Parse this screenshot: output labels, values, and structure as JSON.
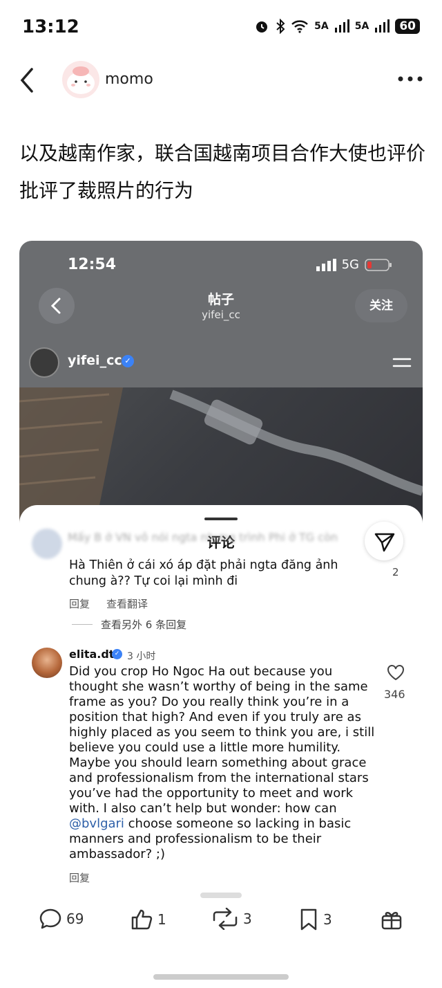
{
  "status_bar": {
    "time": "13:12",
    "network_1": "5A",
    "network_2": "5A",
    "battery": "60"
  },
  "header": {
    "author": "momo"
  },
  "post": {
    "text": "以及越南作家，联合国越南项目合作大使也评价批评了裁照片的行为"
  },
  "screenshot": {
    "status_time": "12:54",
    "network": "5G",
    "page_title": "帖子",
    "page_subtitle": "yifei_cc",
    "follow_label": "关注",
    "post_user": "yifei_cc",
    "sheet_title": "评论",
    "comment1": {
      "blurred_text": "Mấy B ở VN vô nói ngta nhưng trình Phi ở TG còn",
      "text": "Hà Thiên ở cái xó áp đặt phải ngta đăng ảnh chung à?? Tự coi lại mình đi",
      "likes": "2",
      "reply_label": "回复",
      "translate_label": "查看翻译",
      "more_replies": "查看另外 6 条回复"
    },
    "comment2": {
      "user": "elita.dt",
      "time": "3 小时",
      "text_before_mention": "Did you crop Ho Ngoc Ha out because you thought she wasn’t worthy of being in the same frame as you? Do you really think you’re in a position that high? And even if you truly are as highly placed as you seem to think you are, i still believe you could use a little more humility. Maybe you should learn something about grace and professionalism from the international stars you’ve had the opportunity to meet and work with. I also can’t help but wonder: how can ",
      "mention": "@bvlgari",
      "text_after_mention": " choose someone so lacking in basic manners and professionalism to be their ambassador? ;)",
      "likes": "346",
      "reply_label": "回复"
    }
  },
  "bottom_bar": {
    "comments": "69",
    "likes": "1",
    "reposts": "3",
    "saves": "3"
  }
}
